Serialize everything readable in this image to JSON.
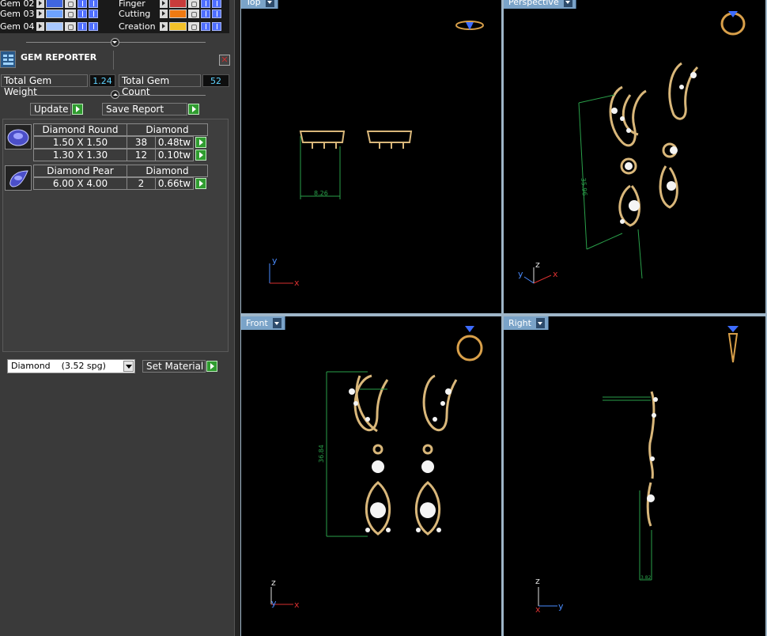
{
  "gem_rows": [
    {
      "label": "Gem 02",
      "color": "#3f66e0"
    },
    {
      "label": "Gem 03",
      "color": "#6ea3ff"
    },
    {
      "label": "Gem 04",
      "color": "#a8c8ff"
    }
  ],
  "material_rows": [
    {
      "label": "Finger",
      "color": "#c83b3b"
    },
    {
      "label": "Cutting",
      "color": "#f07a12"
    },
    {
      "label": "Creation",
      "color": "#f3c12a"
    }
  ],
  "reporter": {
    "title": "GEM REPORTER",
    "close": "✕",
    "total_weight_label": "Total Gem Weight",
    "total_weight_value": "1.24",
    "total_count_label": "Total Gem Count",
    "total_count_value": "52",
    "update_label": "Update",
    "save_label": "Save Report"
  },
  "gems": [
    {
      "name": "Diamond Round",
      "material": "Diamond",
      "sizes": [
        {
          "size": "1.50 X 1.50",
          "count": "38",
          "weight": "0.48tw"
        },
        {
          "size": "1.30 X 1.30",
          "count": "12",
          "weight": "0.10tw"
        }
      ]
    },
    {
      "name": "Diamond Pear",
      "material": "Diamond",
      "sizes": [
        {
          "size": "6.00 X 4.00",
          "count": "2",
          "weight": "0.66tw"
        }
      ]
    }
  ],
  "material_select": {
    "value": "Diamond    (3.52 spg)",
    "set_label": "Set Material"
  },
  "viewports": {
    "top": {
      "label": "Top",
      "dim": "8.26"
    },
    "perspective": {
      "label": "Perspective",
      "dim": "35.96"
    },
    "front": {
      "label": "Front",
      "dim": "36.84"
    },
    "right": {
      "label": "Right",
      "dim": "3.82"
    }
  },
  "axes": {
    "x": "x",
    "y": "y",
    "z": "z"
  },
  "colors": {
    "gold": "#d9b77a",
    "axis_x": "#d83030",
    "axis_y": "#4a8cff",
    "axis_z": "#e0e0e0",
    "dim": "#2aa04a",
    "viewport_tab": "#7aa3c8"
  }
}
